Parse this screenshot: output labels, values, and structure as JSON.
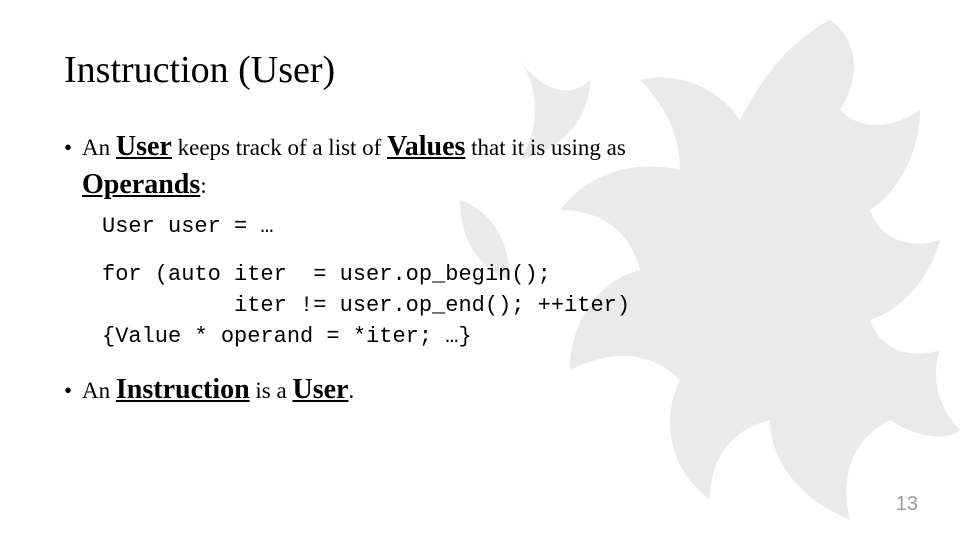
{
  "title": "Instruction (User)",
  "bullet1": {
    "t1": "An ",
    "term1": "User",
    "t2": " keeps track of a list of ",
    "term2": "Values",
    "t3": " that it is using as ",
    "term3": "Operands",
    "t4": ":"
  },
  "code1": "User user = …",
  "code2": "for (auto iter  = user.op_begin();\n          iter != user.op_end(); ++iter)\n{Value * operand = *iter; …}",
  "bullet2": {
    "t1": "An ",
    "term1": "Instruction",
    "t2": " is a ",
    "term2": "User",
    "t3": "."
  },
  "page_number": "13"
}
